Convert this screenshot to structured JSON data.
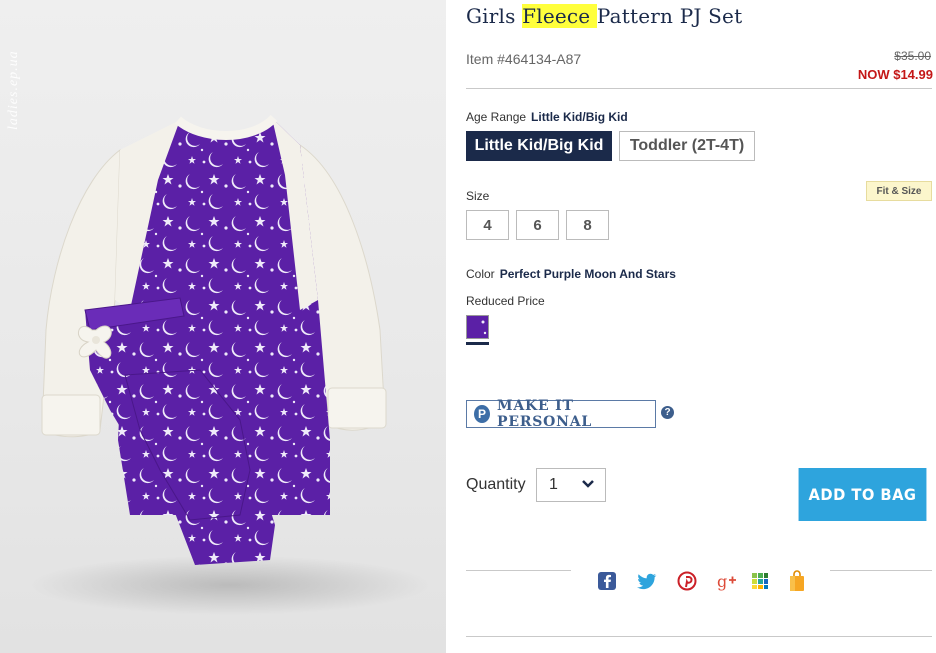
{
  "product": {
    "title_before": "Girls ",
    "title_highlight": "Fleece ",
    "title_after": "Pattern PJ Set",
    "item_number": "Item #464134-A87",
    "price_original": "$35.00",
    "price_now": "NOW $14.99"
  },
  "image": {
    "watermark": "ladies.ep.ua",
    "fabric_color": "#5b20a6",
    "cream_color": "#f3f1ea"
  },
  "age_range": {
    "label": "Age Range",
    "selected_value": "Little Kid/Big Kid",
    "options": [
      "Little Kid/Big Kid",
      "Toddler (2T-4T)"
    ]
  },
  "size": {
    "label": "Size",
    "fit_link": "Fit & Size",
    "options": [
      "4",
      "6",
      "8"
    ]
  },
  "color": {
    "label": "Color",
    "selected_value": "Perfect Purple Moon And Stars",
    "group_label": "Reduced Price"
  },
  "personalize": {
    "icon_letter": "P",
    "label": "MAKE IT PERSONAL",
    "help_icon": "?"
  },
  "quantity": {
    "label": "Quantity",
    "value": "1"
  },
  "cart": {
    "add_label": "ADD TO BAG"
  },
  "share": {
    "icons": [
      "facebook-icon",
      "twitter-icon",
      "pinterest-icon",
      "google-plus-icon",
      "polyvore-icon",
      "shopping-bag-icon"
    ]
  },
  "colors": {
    "navy": "#1b2a4a",
    "accent_blue": "#2ea4dd",
    "sale_red": "#c41717",
    "highlight": "#ffff3c"
  }
}
